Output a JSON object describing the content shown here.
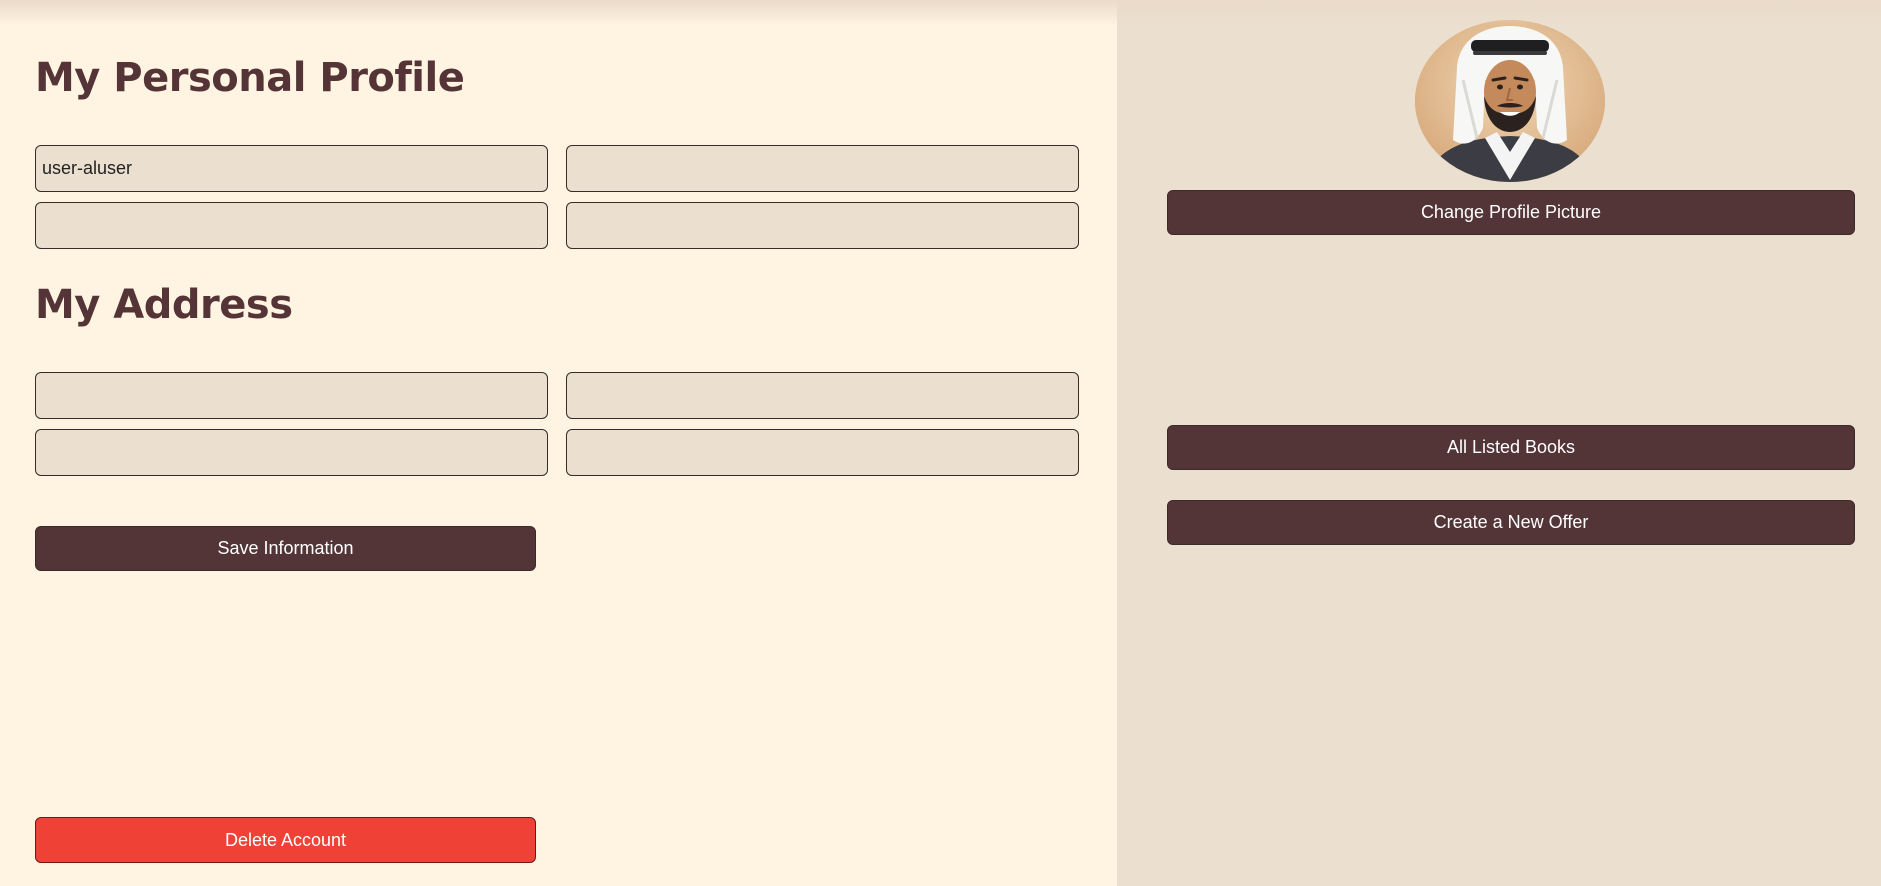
{
  "profile": {
    "title": "My Personal Profile",
    "fields": [
      {
        "value": "user-aluser",
        "placeholder": ""
      },
      {
        "value": "",
        "placeholder": ""
      },
      {
        "value": "",
        "placeholder": ""
      },
      {
        "value": "",
        "placeholder": ""
      }
    ]
  },
  "address": {
    "title": "My Address",
    "fields": [
      {
        "value": "",
        "placeholder": ""
      },
      {
        "value": "",
        "placeholder": ""
      },
      {
        "value": "",
        "placeholder": ""
      },
      {
        "value": "",
        "placeholder": ""
      }
    ]
  },
  "actions": {
    "save_label": "Save Information",
    "delete_label": "Delete Account"
  },
  "sidebar": {
    "avatar_icon": "user-avatar",
    "change_picture_label": "Change Profile Picture",
    "all_books_label": "All Listed Books",
    "new_offer_label": "Create a New Offer"
  },
  "colors": {
    "page_bg": "#fff3e2",
    "panel_bg": "#ebdfcf",
    "primary": "#533538",
    "danger": "#ef4135"
  }
}
